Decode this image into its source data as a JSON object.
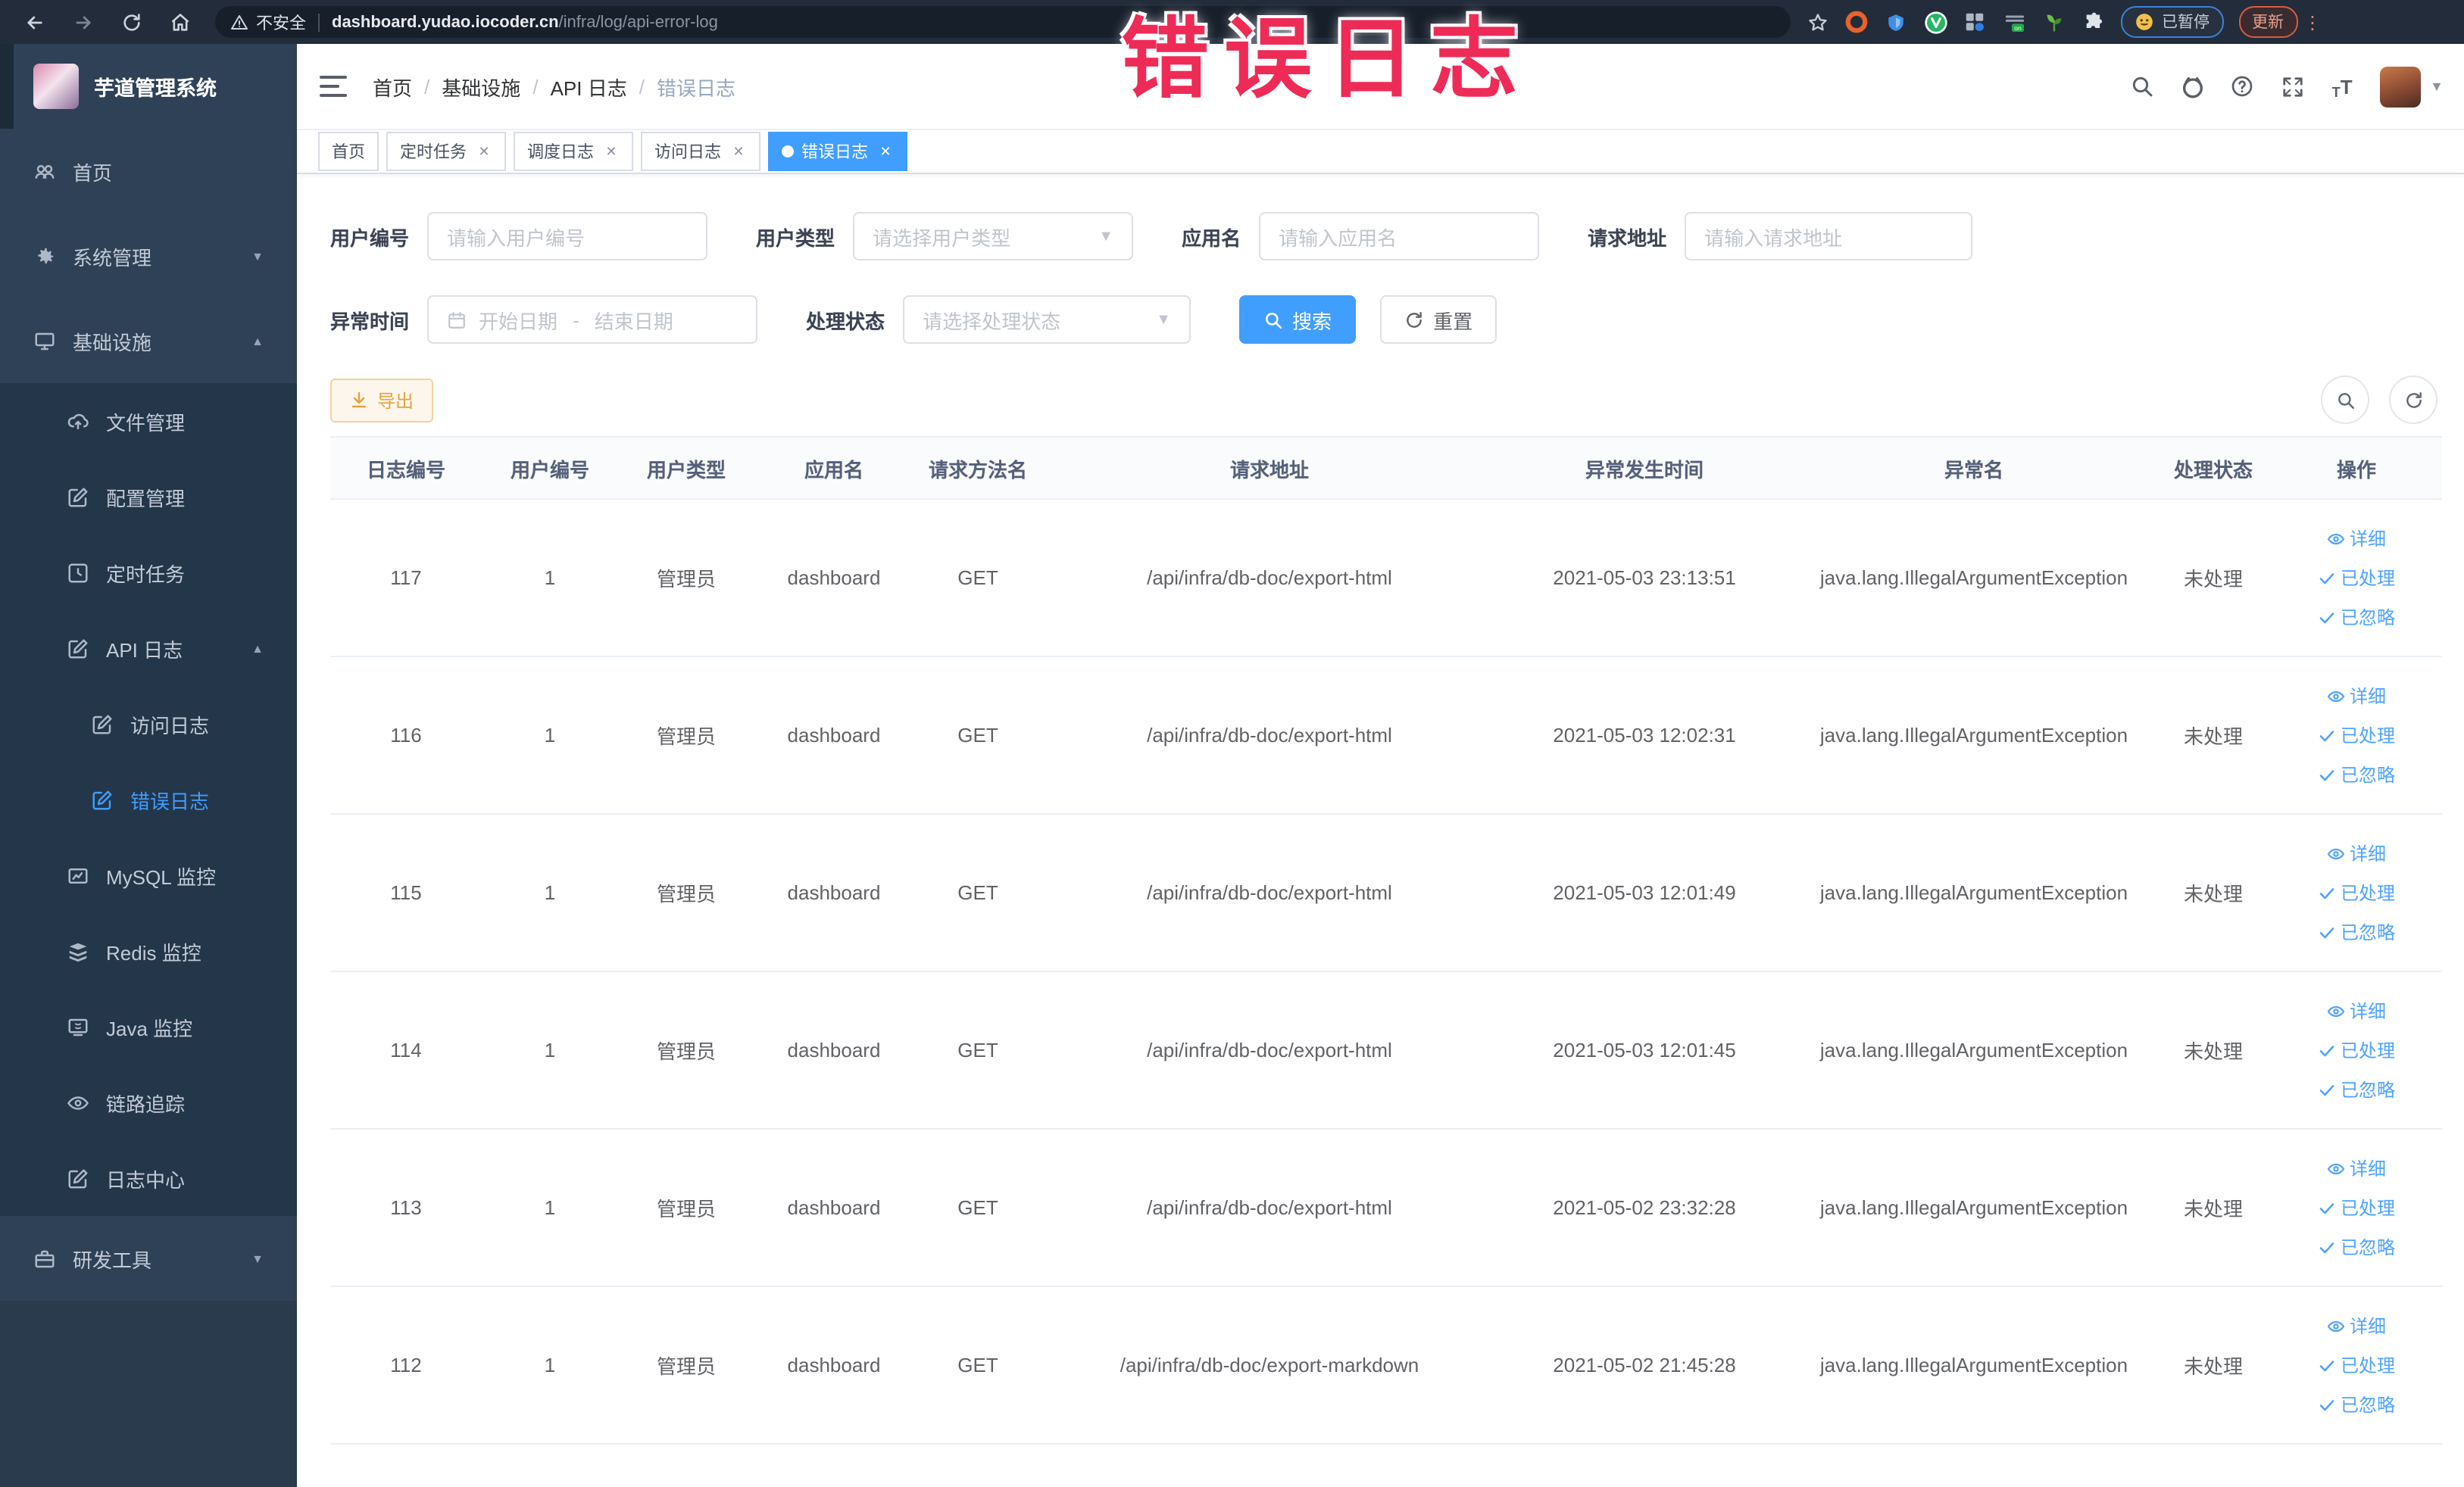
{
  "browser": {
    "security_label": "不安全",
    "url_domain": "dashboard.yudao.iocoder.cn",
    "url_path": "/infra/log/api-error-log",
    "paused_chip": "已暂停",
    "update_chip": "更新"
  },
  "overlay": {
    "text": "错误日志",
    "color": "#ee2b57"
  },
  "app": {
    "title": "芋道管理系统"
  },
  "breadcrumb": {
    "items": [
      "首页",
      "基础设施",
      "API 日志",
      "错误日志"
    ]
  },
  "tags": [
    {
      "label": "首页",
      "closable": false,
      "active": false
    },
    {
      "label": "定时任务",
      "closable": true,
      "active": false
    },
    {
      "label": "调度日志",
      "closable": true,
      "active": false
    },
    {
      "label": "访问日志",
      "closable": true,
      "active": false
    },
    {
      "label": "错误日志",
      "closable": true,
      "active": true
    }
  ],
  "sidebar": {
    "items": [
      {
        "name": "home",
        "icon": "home-icon",
        "label": "首页",
        "level": 1
      },
      {
        "name": "system-management",
        "icon": "gear-icon",
        "label": "系统管理",
        "level": 1,
        "chevron": "down"
      },
      {
        "name": "infrastructure",
        "icon": "monitor-icon",
        "label": "基础设施",
        "level": 1,
        "chevron": "up"
      },
      {
        "name": "file-management",
        "icon": "cloud-upload-icon",
        "label": "文件管理",
        "level": 2
      },
      {
        "name": "config-management",
        "icon": "edit-square-icon",
        "label": "配置管理",
        "level": 2
      },
      {
        "name": "scheduled-tasks",
        "icon": "clock-icon",
        "label": "定时任务",
        "level": 2
      },
      {
        "name": "api-log",
        "icon": "edit-square-icon",
        "label": "API 日志",
        "level": 2,
        "chevron": "up"
      },
      {
        "name": "access-log",
        "icon": "edit-square-icon",
        "label": "访问日志",
        "level": 3
      },
      {
        "name": "error-log",
        "icon": "edit-square-icon",
        "label": "错误日志",
        "level": 3,
        "active": true
      },
      {
        "name": "mysql-monitor",
        "icon": "mysql-icon",
        "label": "MySQL 监控",
        "level": 2
      },
      {
        "name": "redis-monitor",
        "icon": "redis-icon",
        "label": "Redis 监控",
        "level": 2
      },
      {
        "name": "java-monitor",
        "icon": "java-icon",
        "label": "Java 监控",
        "level": 2
      },
      {
        "name": "trace",
        "icon": "eye-icon",
        "label": "链路追踪",
        "level": 2
      },
      {
        "name": "log-center",
        "icon": "edit-square-icon",
        "label": "日志中心",
        "level": 2
      },
      {
        "name": "dev-tools",
        "icon": "toolbox-icon",
        "label": "研发工具",
        "level": 1,
        "chevron": "down"
      }
    ]
  },
  "filters": {
    "user_id": {
      "label": "用户编号",
      "placeholder": "请输入用户编号"
    },
    "user_type": {
      "label": "用户类型",
      "placeholder": "请选择用户类型"
    },
    "app_name": {
      "label": "应用名",
      "placeholder": "请输入应用名"
    },
    "request_url": {
      "label": "请求地址",
      "placeholder": "请输入请求地址"
    },
    "exception_time": {
      "label": "异常时间",
      "start_placeholder": "开始日期",
      "separator": "-",
      "end_placeholder": "结束日期"
    },
    "process_status": {
      "label": "处理状态",
      "placeholder": "请选择处理状态"
    },
    "search_label": "搜索",
    "reset_label": "重置"
  },
  "toolbar": {
    "export_label": "导出"
  },
  "table": {
    "columns": [
      "日志编号",
      "用户编号",
      "用户类型",
      "应用名",
      "请求方法名",
      "请求地址",
      "异常发生时间",
      "异常名",
      "处理状态",
      "操作"
    ],
    "action_labels": {
      "detail": "详细",
      "processed": "已处理",
      "ignored": "已忽略"
    },
    "rows": [
      {
        "id": "117",
        "user_id": "1",
        "user_type": "管理员",
        "app": "dashboard",
        "method": "GET",
        "url": "/api/infra/db-doc/export-html",
        "time": "2021-05-03 23:13:51",
        "exception": "java.lang.IllegalArgumentException",
        "status": "未处理"
      },
      {
        "id": "116",
        "user_id": "1",
        "user_type": "管理员",
        "app": "dashboard",
        "method": "GET",
        "url": "/api/infra/db-doc/export-html",
        "time": "2021-05-03 12:02:31",
        "exception": "java.lang.IllegalArgumentException",
        "status": "未处理"
      },
      {
        "id": "115",
        "user_id": "1",
        "user_type": "管理员",
        "app": "dashboard",
        "method": "GET",
        "url": "/api/infra/db-doc/export-html",
        "time": "2021-05-03 12:01:49",
        "exception": "java.lang.IllegalArgumentException",
        "status": "未处理"
      },
      {
        "id": "114",
        "user_id": "1",
        "user_type": "管理员",
        "app": "dashboard",
        "method": "GET",
        "url": "/api/infra/db-doc/export-html",
        "time": "2021-05-03 12:01:45",
        "exception": "java.lang.IllegalArgumentException",
        "status": "未处理"
      },
      {
        "id": "113",
        "user_id": "1",
        "user_type": "管理员",
        "app": "dashboard",
        "method": "GET",
        "url": "/api/infra/db-doc/export-html",
        "time": "2021-05-02 23:32:28",
        "exception": "java.lang.IllegalArgumentException",
        "status": "未处理"
      },
      {
        "id": "112",
        "user_id": "1",
        "user_type": "管理员",
        "app": "dashboard",
        "method": "GET",
        "url": "/api/infra/db-doc/export-markdown",
        "time": "2021-05-02 21:45:28",
        "exception": "java.lang.IllegalArgumentException",
        "status": "未处理"
      }
    ]
  }
}
